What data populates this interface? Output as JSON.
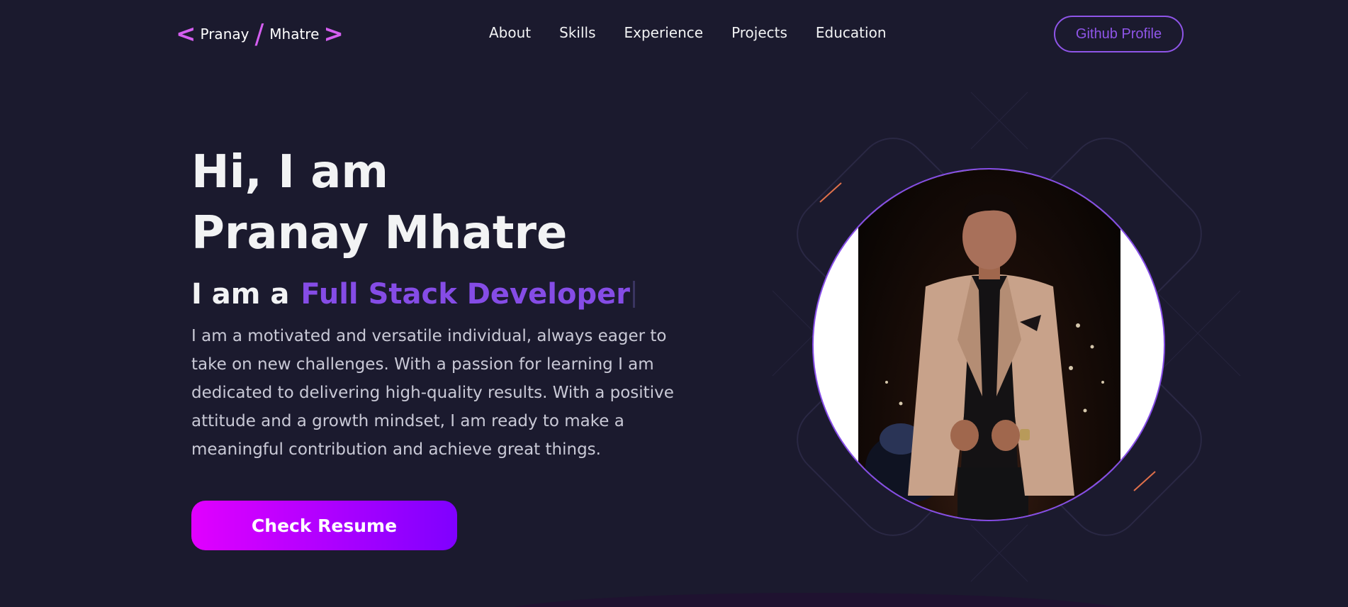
{
  "logo": {
    "left_bracket": "<",
    "first_name": "Pranay",
    "slash": "/",
    "last_name": "Mhatre",
    "right_bracket": ">"
  },
  "nav": {
    "links": [
      "About",
      "Skills",
      "Experience",
      "Projects",
      "Education"
    ],
    "github_label": "Github Profile"
  },
  "hero": {
    "greeting": "Hi, I am",
    "name": "Pranay Mhatre",
    "role_prefix": "I am a",
    "role_title": "Full Stack Developer",
    "description": "I am a motivated and versatile individual, always eager to take on new challenges. With a passion for learning I am dedicated to delivering high-quality results. With a positive attitude and a growth mindset, I am ready to make a meaningful contribution and achieve great things.",
    "resume_label": "Check Resume"
  },
  "colors": {
    "background": "#1b1a2e",
    "accent": "#854ce6",
    "logo_accent": "#d45ef0",
    "button_gradient_start": "#e100ff",
    "button_gradient_end": "#7f00ff"
  }
}
